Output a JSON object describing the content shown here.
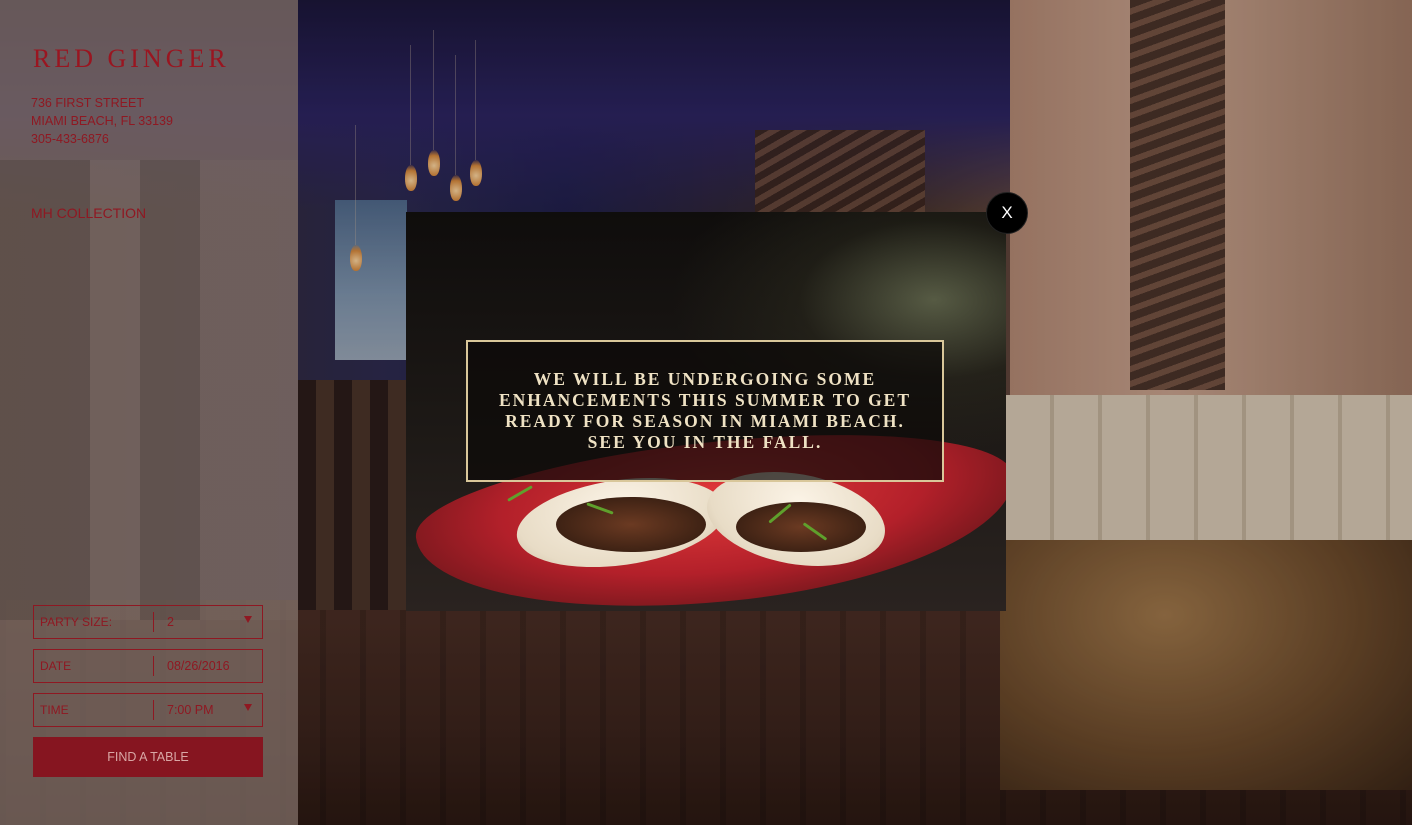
{
  "brand": {
    "name": "RED GINGER"
  },
  "address": {
    "street": "736 FIRST STREET",
    "city": "MIAMI BEACH, FL 33139",
    "phone": "305-433-6876"
  },
  "nav": {
    "collection_link": "MH COLLECTION"
  },
  "reservation": {
    "party_size": {
      "label": "PARTY SIZE:",
      "value": "2"
    },
    "date": {
      "label": "DATE",
      "value": "08/26/2016"
    },
    "time": {
      "label": "TIME",
      "value": "7:00 PM"
    },
    "submit_label": "FIND A TABLE"
  },
  "modal": {
    "close_label": "X",
    "message_lines": [
      "WE WILL BE UNDERGOING SOME",
      "ENHANCEMENTS THIS SUMMER TO GET",
      "READY FOR SEASON IN MIAMI BEACH.",
      "SEE YOU IN THE FALL."
    ]
  },
  "colors": {
    "brand_red": "#8f1822",
    "button_red": "#861520",
    "modal_frame": "#d9c79a"
  }
}
